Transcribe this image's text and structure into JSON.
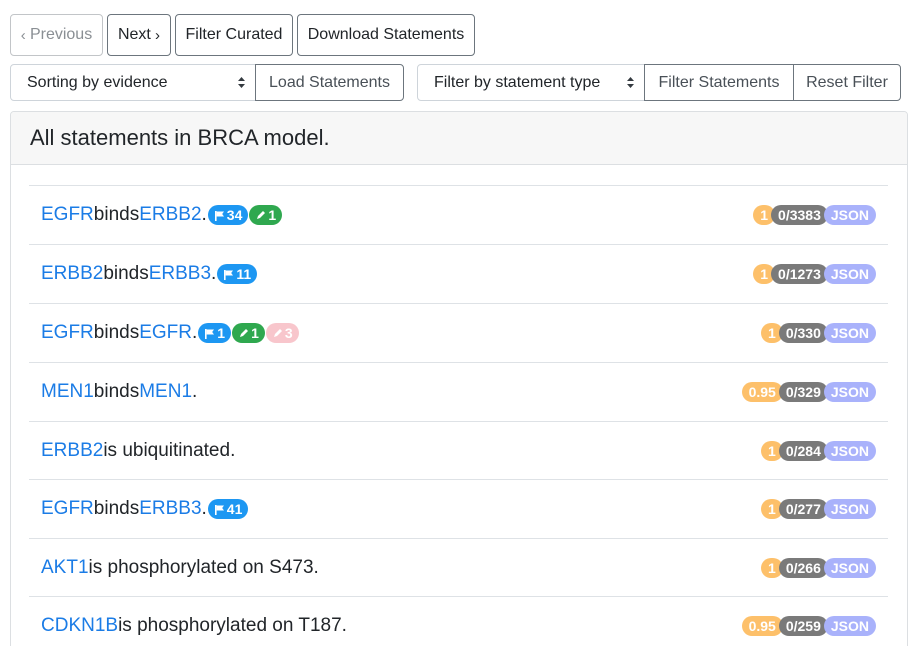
{
  "toolbar": {
    "previous": "Previous",
    "next": "Next",
    "filter_curated": "Filter Curated",
    "download": "Download Statements",
    "sort_select": "Sorting by evidence",
    "load": "Load Statements",
    "type_select": "Filter by statement type",
    "filter_statements": "Filter Statements",
    "reset_filter": "Reset Filter"
  },
  "header": {
    "title": "All statements in BRCA model."
  },
  "statements": [
    {
      "parts": [
        "EGFR",
        " binds ",
        "ERBB2",
        "."
      ],
      "pills": [
        {
          "kind": "flag",
          "value": "34"
        },
        {
          "kind": "pen",
          "value": "1"
        }
      ],
      "belief": "1",
      "count": "0/3383",
      "json": "JSON"
    },
    {
      "parts": [
        "ERBB2",
        " binds ",
        "ERBB3",
        "."
      ],
      "pills": [
        {
          "kind": "flag",
          "value": "11"
        }
      ],
      "belief": "1",
      "count": "0/1273",
      "json": "JSON"
    },
    {
      "parts": [
        "EGFR",
        " binds ",
        "EGFR",
        "."
      ],
      "pills": [
        {
          "kind": "flag",
          "value": "1"
        },
        {
          "kind": "pen",
          "value": "1"
        },
        {
          "kind": "pen-incorrect",
          "value": "3"
        }
      ],
      "belief": "1",
      "count": "0/330",
      "json": "JSON"
    },
    {
      "parts": [
        "MEN1",
        " binds ",
        "MEN1",
        "."
      ],
      "pills": [],
      "belief": "0.95",
      "count": "0/329",
      "json": "JSON"
    },
    {
      "parts": [
        "ERBB2",
        " is ubiquitinated."
      ],
      "pills": [],
      "belief": "1",
      "count": "0/284",
      "json": "JSON"
    },
    {
      "parts": [
        "EGFR",
        " binds ",
        "ERBB3",
        "."
      ],
      "pills": [
        {
          "kind": "flag",
          "value": "41"
        }
      ],
      "belief": "1",
      "count": "0/277",
      "json": "JSON"
    },
    {
      "parts": [
        "AKT1",
        " is phosphorylated on S473."
      ],
      "pills": [],
      "belief": "1",
      "count": "0/266",
      "json": "JSON"
    },
    {
      "parts": [
        "CDKN1B",
        " is phosphorylated on T187."
      ],
      "pills": [],
      "belief": "0.95",
      "count": "0/259",
      "json": "JSON"
    }
  ]
}
